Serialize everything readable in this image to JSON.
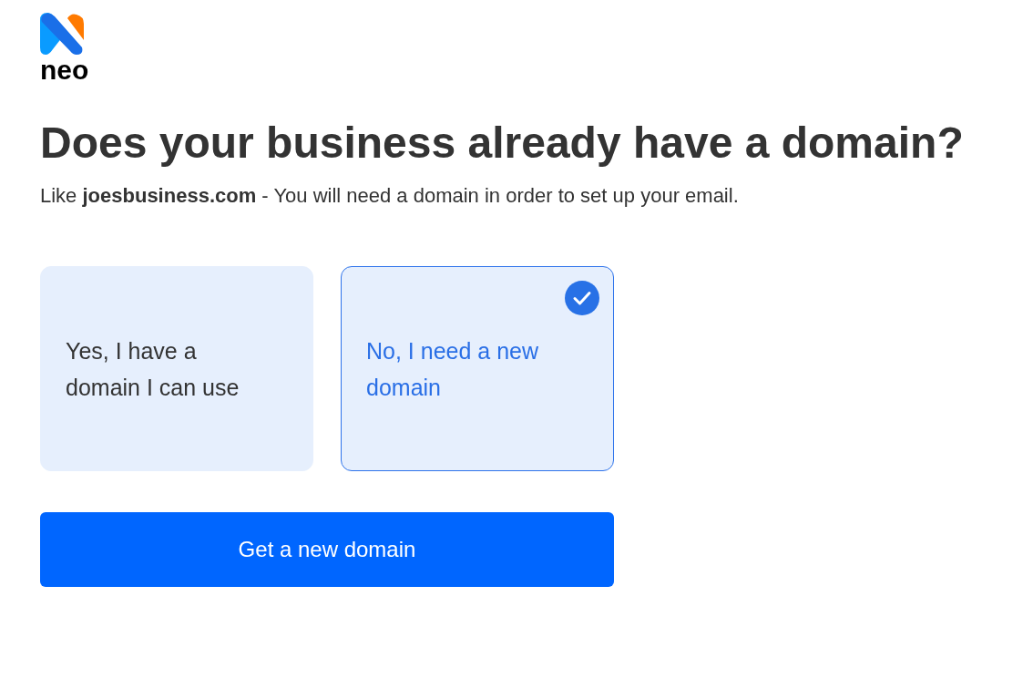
{
  "logo": {
    "text": "neo"
  },
  "heading": "Does your business already have a domain?",
  "subtitle": "Like **joesbusiness.com** - You will need a domain in order to set up your email.",
  "options": [
    {
      "label": "Yes, I have a domain I can use",
      "selected": false
    },
    {
      "label": "No, I need a new domain",
      "selected": true
    }
  ],
  "button": {
    "label": "Get a new domain"
  }
}
